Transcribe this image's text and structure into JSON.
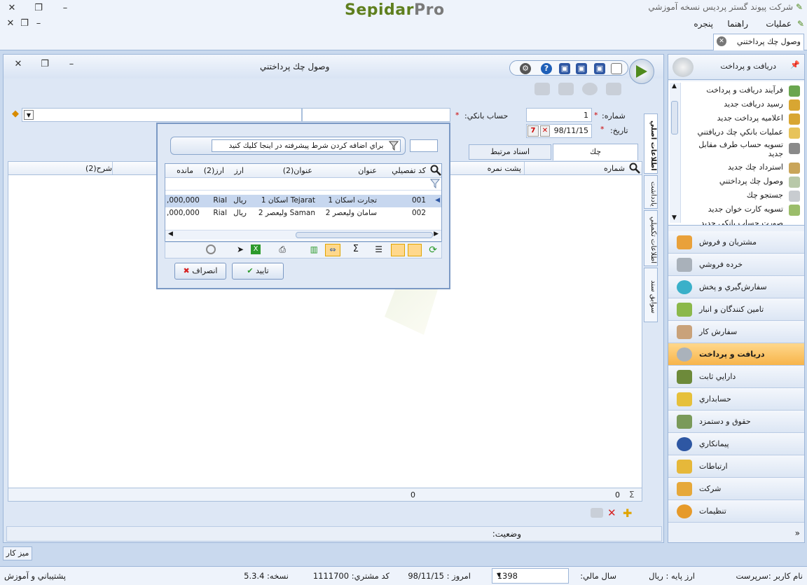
{
  "app": {
    "company": "شركت پيوند گستر پرديس نسخه آموزشي",
    "logo_main": "Sepidar",
    "logo_pro": "Pro"
  },
  "menu": {
    "items": [
      "عمليات",
      "راهنما",
      "پنجره"
    ]
  },
  "doc_tab": {
    "label": "وصول چك پرداختني"
  },
  "form": {
    "title": "وصول چك پرداختني",
    "number_label": "شماره:",
    "number_value": "1",
    "date_label": "تاريخ:",
    "date_value": "98/11/15",
    "bank_label": "حساب بانكي:",
    "tabs": [
      "چك",
      "اسناد مرتبط"
    ],
    "side_tabs": [
      "اطلاعات اصلي",
      "يادداشت",
      "اطلاعات تكميلي",
      "سوابق سند"
    ],
    "grid_headers": {
      "number": "شماره",
      "back_number": "پشت نمره",
      "desc": "شرح(2)"
    },
    "footer_values": {
      "count": "0",
      "amount": "0"
    },
    "status_label": "وضعيت:"
  },
  "popup": {
    "advanced_filter": "براي اضافه كردن شرط پيشرفته در اينجا كليك كنيد",
    "columns": [
      "كد تفصيلي",
      "عنوان",
      "عنوان(2)",
      "ارز",
      "ارز(2)",
      "مانده"
    ],
    "rows": [
      {
        "code": "001",
        "title": "تجارت اسكان 1",
        "title2": "Tejarat اسكان 1",
        "currency": "ريال",
        "currency2": "Rial",
        "balance": "000,000,"
      },
      {
        "code": "002",
        "title": "سامان وليعصر 2",
        "title2": "Saman وليعصر 2",
        "currency": "ريال",
        "currency2": "Rial",
        "balance": "000,000,"
      }
    ],
    "ok_label": "تاييد",
    "cancel_label": "انصراف"
  },
  "nav": {
    "header": "دريافت و پرداخت",
    "links": [
      "فرآيند دريافت و پرداخت",
      "رسيد دريافت جديد",
      "اعلاميه پرداخت جديد",
      "عمليات بانكي چك دريافتني",
      "تسويه حساب طرف مقابل جديد",
      "استرداد چك جديد",
      "وصول چك پرداختني",
      "جستجو چك",
      "تسويه كارت خوان جديد",
      "صورت حساب بانكي جديد"
    ],
    "modules": [
      "مشتريان و فروش",
      "خرده فروشي",
      "سفارش‌گيري و پخش",
      "تامين كنندگان و انبار",
      "سفارش كار",
      "دريافت و پرداخت",
      "دارايي ثابت",
      "حسابداري",
      "حقوق و دستمزد",
      "پيمانكاري",
      "ارتباطات",
      "شركت",
      "تنظيمات"
    ],
    "active_module": "دريافت و پرداخت"
  },
  "taskbar": {
    "desk": "ميز كار"
  },
  "statusbar": {
    "user": "نام كاربر :سرپرست",
    "base_currency": "ارز پايه : ريال",
    "fiscal_year_label": "سال مالي:",
    "fiscal_year": "1398",
    "today": "امروز : 98/11/15",
    "customer_code": "كد مشتري: 1111700",
    "version": "نسخه: 5.3.4",
    "support": "پشتيباني و آموزش"
  },
  "colors": {
    "accent": "#f7b44a",
    "brand_green": "#5f7f1e",
    "border": "#9db6d8"
  }
}
